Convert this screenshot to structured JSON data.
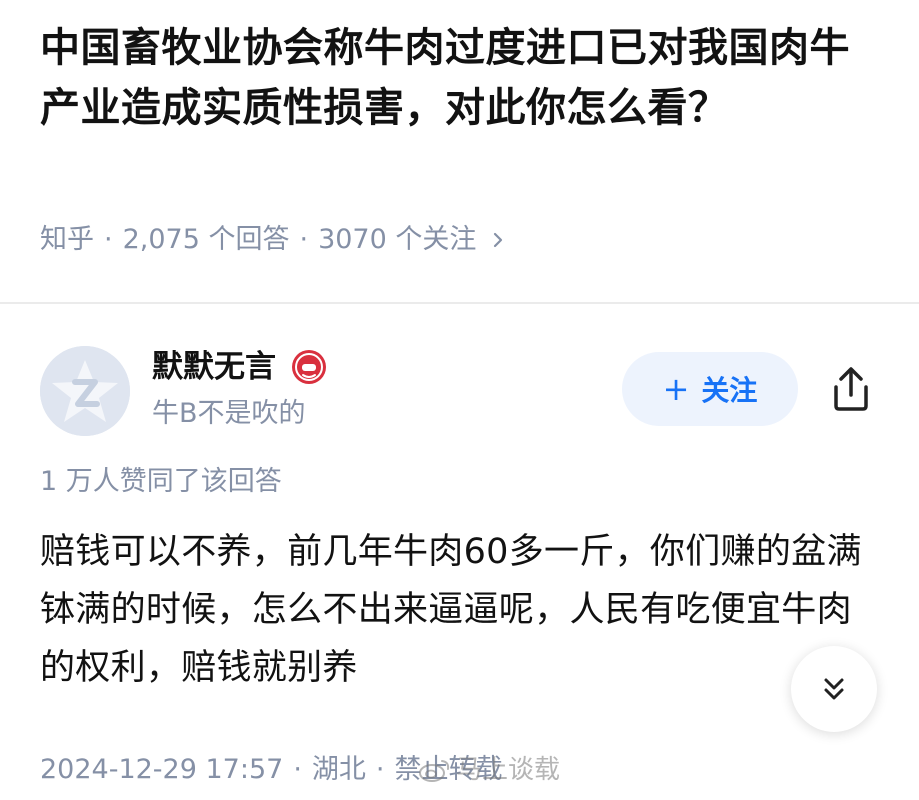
{
  "question": {
    "title": "中国畜牧业协会称牛肉过度进口已对我国肉牛产业造成实质性损害，对此你怎么看？",
    "source": "知乎",
    "answer_count": "2,075 个回答",
    "follower_count": "3070 个关注",
    "separator": "·"
  },
  "author": {
    "name": "默默无言",
    "bio": "牛B不是吹的",
    "follow_label": "关注",
    "follow_plus": "+"
  },
  "answer": {
    "vote_summary": "1 万人赞同了该回答",
    "body": "赔钱可以不养，前几年牛肉60多一斤，你们赚的盆满钵满的时候，怎么不出来逼逼呢，人民有吃便宜牛肉的权利，赔钱就别养",
    "date": "2024-12-29 17:57",
    "location": "湖北",
    "copyright": "禁止转载"
  },
  "watermark": {
    "text": "马上谈载"
  },
  "icons": {
    "chevron": "chevron-right-icon",
    "share": "share-icon",
    "expand": "chevron-double-down-icon",
    "badge": "author-badge-icon",
    "avatar": "default-avatar-icon"
  },
  "colors": {
    "accent": "#1772f6",
    "follow_bg": "#edf3fd",
    "meta_gray": "#8590a6",
    "text": "#121212",
    "badge_red": "#d9303e"
  }
}
